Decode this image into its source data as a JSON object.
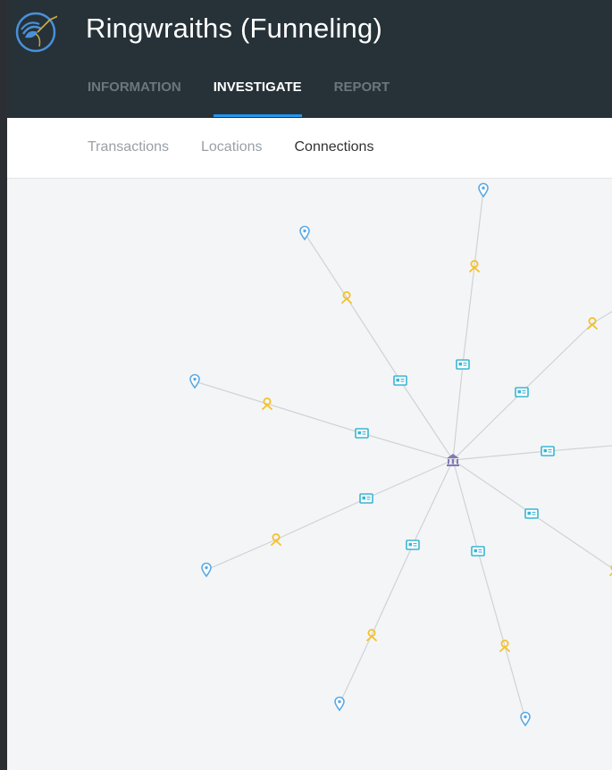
{
  "header": {
    "title": "Ringwraiths (Funneling)",
    "logo_icon": "hummingbird-logo-icon"
  },
  "main_tabs": [
    {
      "label": "INFORMATION",
      "active": false
    },
    {
      "label": "INVESTIGATE",
      "active": true
    },
    {
      "label": "REPORT",
      "active": false
    }
  ],
  "sub_tabs": [
    {
      "label": "Transactions",
      "active": false
    },
    {
      "label": "Locations",
      "active": false
    },
    {
      "label": "Connections",
      "active": true
    }
  ],
  "graph": {
    "center_icon": "bank-icon",
    "card_icon": "id-card-icon",
    "person_icon": "person-icon",
    "location_icon": "location-pin-icon",
    "colors": {
      "center": "#7e7ab8",
      "card": "#38b6d4",
      "person": "#f5c02a",
      "location": "#5aa9e6",
      "edge": "#cfd3d6"
    }
  }
}
